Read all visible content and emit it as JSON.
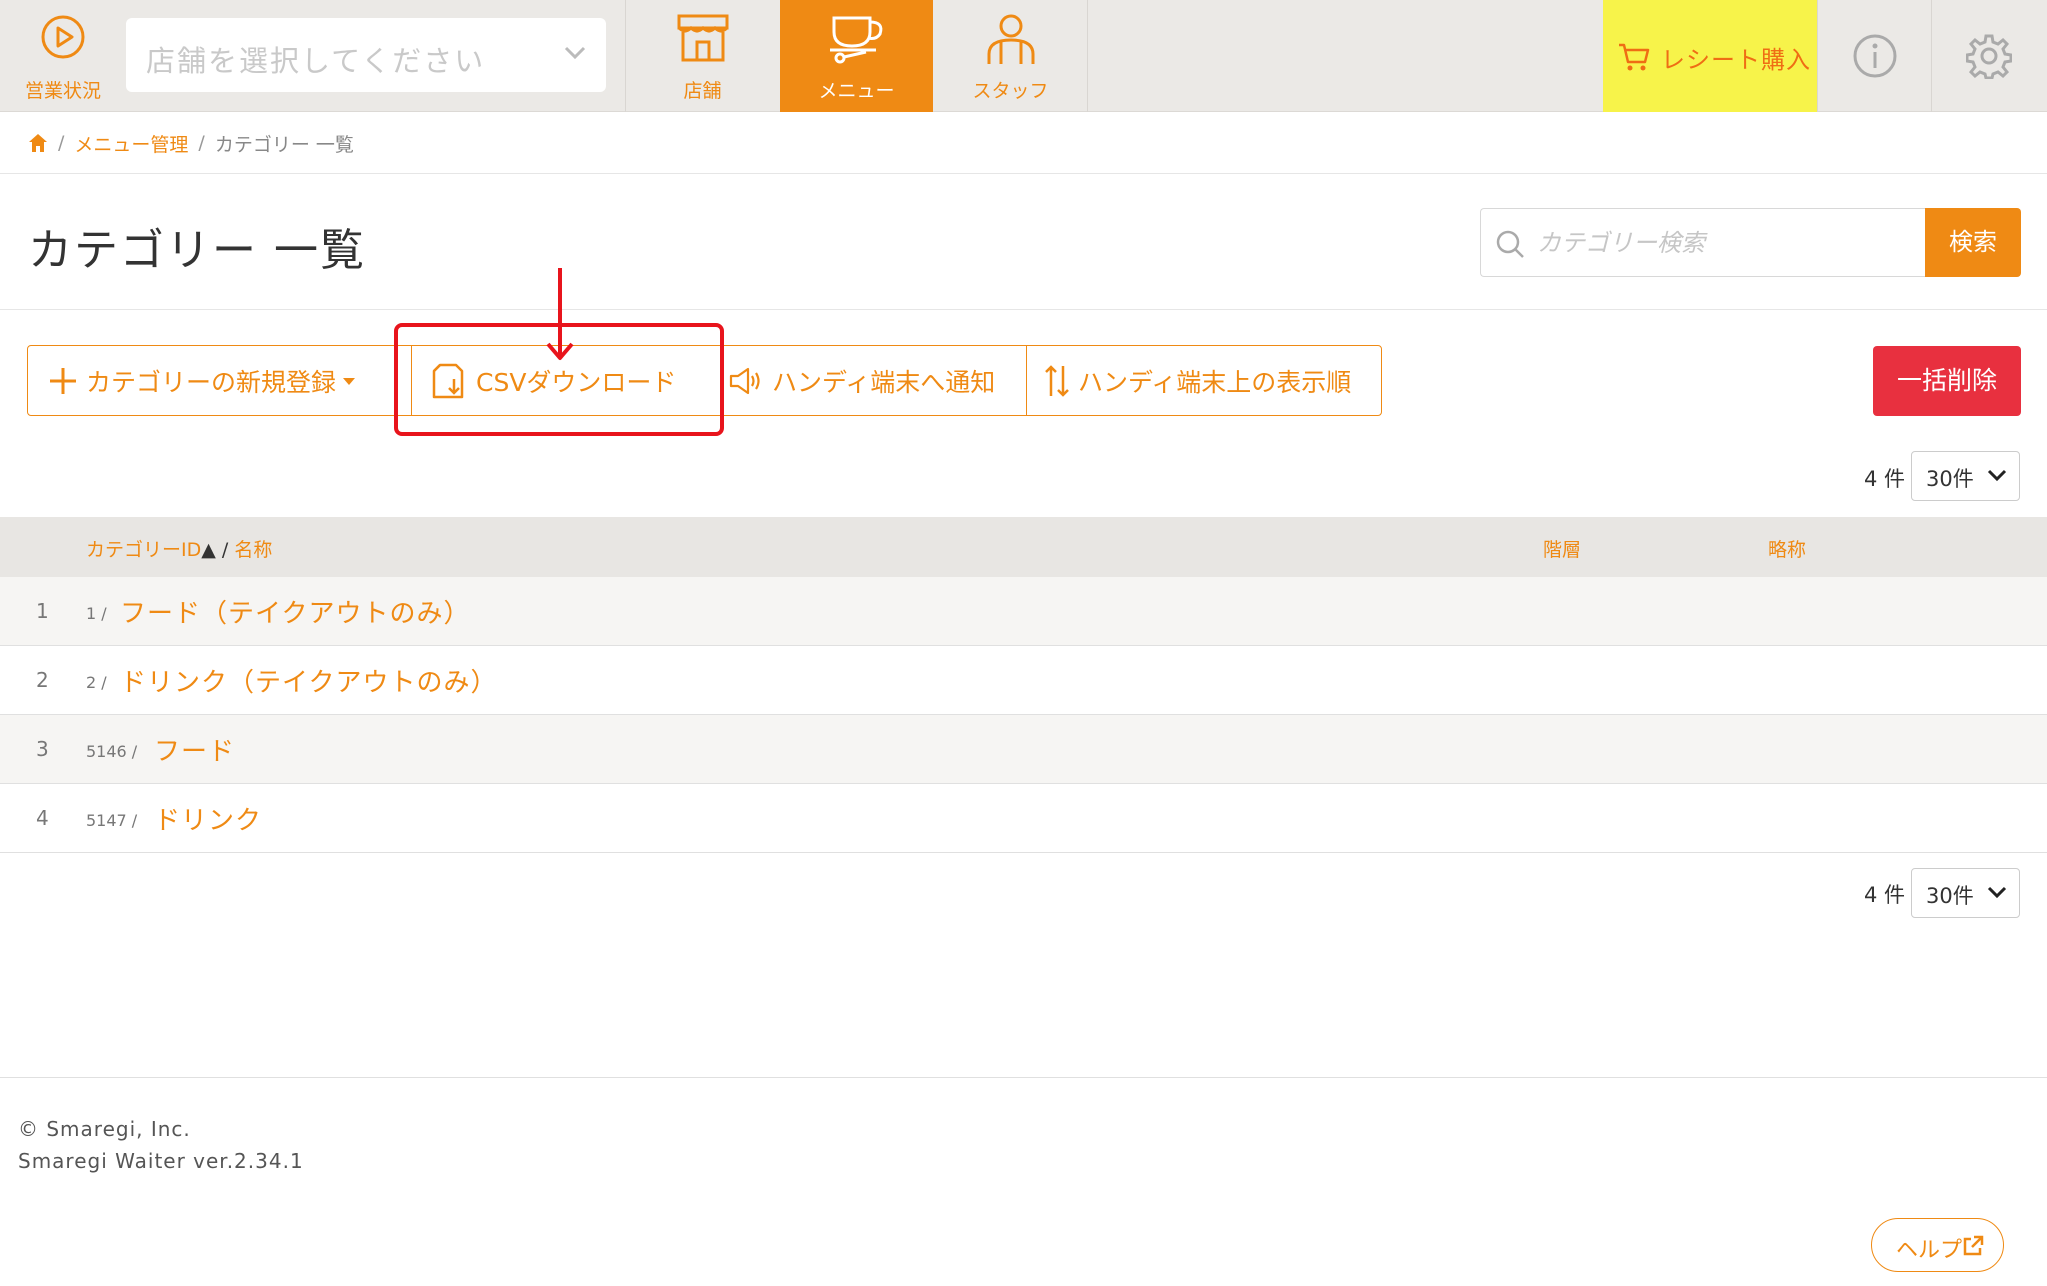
{
  "topbar": {
    "status_label": "営業状況",
    "store_placeholder": "店舗を選択してください",
    "tabs": [
      {
        "label": "店舗"
      },
      {
        "label": "メニュー"
      },
      {
        "label": "スタッフ"
      }
    ],
    "active_tab": "メニュー",
    "receipt_label": "レシート購入",
    "receipt_bg": "#f7f34a"
  },
  "breadcrumb": {
    "home_icon": "home-icon",
    "items": [
      "メニュー管理",
      "カテゴリー 一覧"
    ]
  },
  "page": {
    "title": "カテゴリー 一覧",
    "search_placeholder": "カテゴリー検索",
    "search_button": "検索"
  },
  "toolbar": {
    "new_category": "カテゴリーの新規登録",
    "csv_download": "CSVダウンロード",
    "notify_handy": "ハンディ端末へ通知",
    "handy_order": "ハンディ端末上の表示順",
    "bulk_delete": "一括削除"
  },
  "pagination": {
    "count_text": "4 件",
    "per_page": "30件"
  },
  "table": {
    "headers": {
      "id_label": "カテゴリーID",
      "sort_mark": "▲",
      "slash": "/",
      "name_label": "名称",
      "level": "階層",
      "abbr": "略称"
    },
    "rows": [
      {
        "num": "1",
        "id": "1 /",
        "name": "フード（テイクアウトのみ）"
      },
      {
        "num": "2",
        "id": "2 /",
        "name": "ドリンク（テイクアウトのみ）"
      },
      {
        "num": "3",
        "id": "5146 /",
        "name": "フード"
      },
      {
        "num": "4",
        "id": "5147 /",
        "name": "ドリンク"
      }
    ]
  },
  "footer": {
    "copyright": "© Smaregi, Inc.",
    "version": "Smaregi Waiter ver.2.34.1",
    "help": "ヘルプ"
  },
  "colors": {
    "accent": "#ef8a14",
    "danger": "#e8303f",
    "highlight_box": "#e8141c"
  }
}
